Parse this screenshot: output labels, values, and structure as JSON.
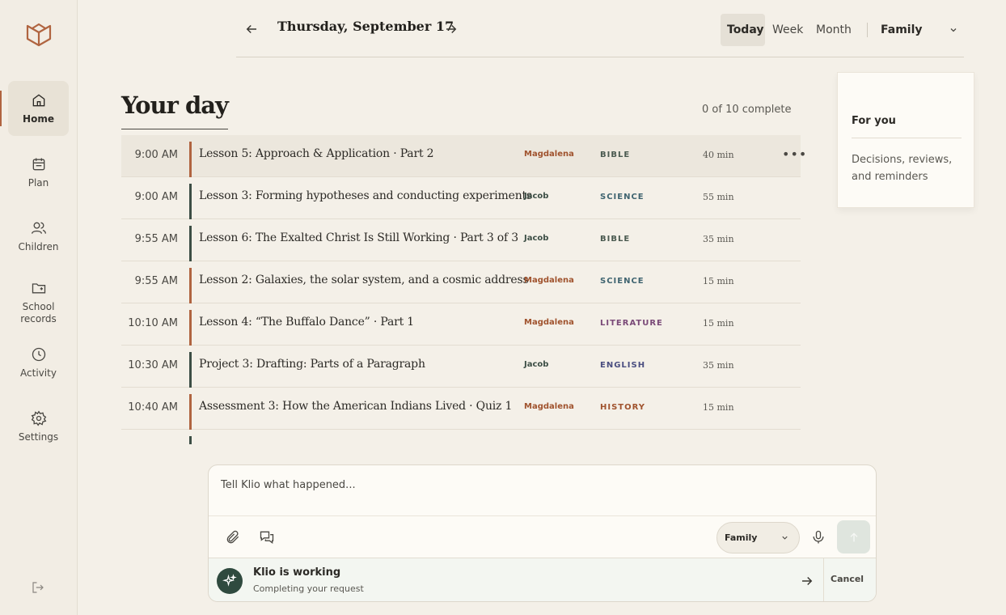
{
  "sidebar": {
    "items": [
      {
        "label": "Home",
        "icon": "home-icon",
        "active": true
      },
      {
        "label": "Plan",
        "icon": "calendar-icon"
      },
      {
        "label": "Children",
        "icon": "users-icon"
      },
      {
        "label": "School records",
        "icon": "folder-icon"
      },
      {
        "label": "Activity",
        "icon": "clock-icon"
      },
      {
        "label": "Settings",
        "icon": "gear-icon"
      }
    ]
  },
  "header": {
    "date": "Thursday, September 17",
    "views": [
      "Today",
      "Week",
      "Month"
    ],
    "active_view": "Today",
    "scope": "Family"
  },
  "main": {
    "title": "Your day",
    "complete_count": "0 of 10 complete",
    "tasks": [
      {
        "time": "9:00 AM",
        "title": "Lesson 5: Approach & Application · Part 2",
        "child": "Magdalena",
        "subject": "BIBLE",
        "duration": "40 min"
      },
      {
        "time": "9:00 AM",
        "title": "Lesson 3: Forming hypotheses and conducting experiments",
        "child": "Jacob",
        "subject": "SCIENCE",
        "duration": "55 min"
      },
      {
        "time": "9:55 AM",
        "title": "Lesson 6: The Exalted Christ Is Still Working · Part 3 of 3",
        "child": "Jacob",
        "subject": "BIBLE",
        "duration": "35 min"
      },
      {
        "time": "9:55 AM",
        "title": "Lesson 2: Galaxies, the solar system, and a cosmic address",
        "child": "Magdalena",
        "subject": "SCIENCE",
        "duration": "15 min"
      },
      {
        "time": "10:10 AM",
        "title": "Lesson 4: “The Buffalo Dance” · Part 1",
        "child": "Magdalena",
        "subject": "LITERATURE",
        "duration": "15 min"
      },
      {
        "time": "10:30 AM",
        "title": "Project 3: Drafting: Parts of a Paragraph",
        "child": "Jacob",
        "subject": "ENGLISH",
        "duration": "35 min"
      },
      {
        "time": "10:40 AM",
        "title": "Assessment 3: How the American Indians Lived · Quiz 1",
        "child": "Magdalena",
        "subject": "HISTORY",
        "duration": "15 min"
      }
    ]
  },
  "for_you": {
    "title": "For you",
    "description": "Decisions, reviews, and reminders"
  },
  "composer": {
    "placeholder": "Tell Klio what happened...",
    "scope": "Family",
    "status_title": "Klio is working",
    "status_subtitle": "Completing your request",
    "cancel_label": "Cancel"
  },
  "colors": {
    "accent": "#b06440",
    "magdalena": "#a0532e",
    "jacob": "#3c4e45",
    "bible": "#4a5a50",
    "science": "#3f6470",
    "literature": "#7a4a78",
    "english": "#4a4e80",
    "history": "#a0532e"
  }
}
